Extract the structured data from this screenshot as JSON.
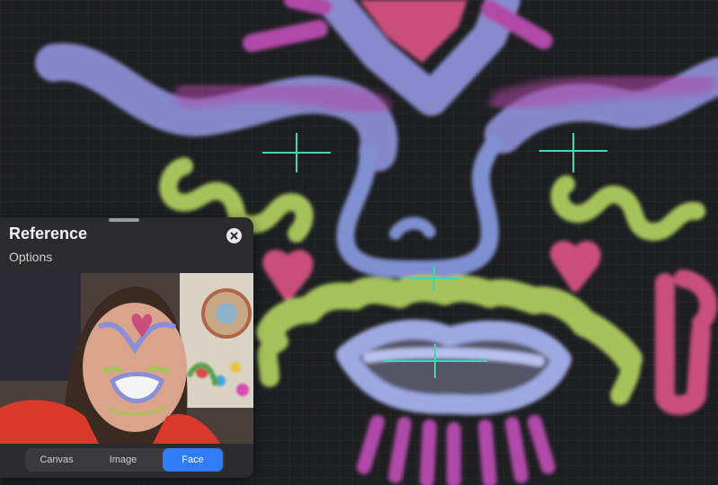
{
  "reference_panel": {
    "title": "Reference",
    "options_label": "Options",
    "close_icon": "close-icon",
    "tabs": [
      {
        "label": "Canvas",
        "active": false
      },
      {
        "label": "Image",
        "active": false
      },
      {
        "label": "Face",
        "active": true
      }
    ],
    "accent_color": "#2f7cf6"
  },
  "canvas": {
    "background": "#1d1e20",
    "guide_color": "#3fd6b0",
    "stroke_colors": {
      "lavender": "#8d8fd6",
      "periwinkle": "#7f8fd0",
      "magenta": "#b04aa8",
      "pink": "#c94f7a",
      "green": "#a6c25a"
    }
  }
}
